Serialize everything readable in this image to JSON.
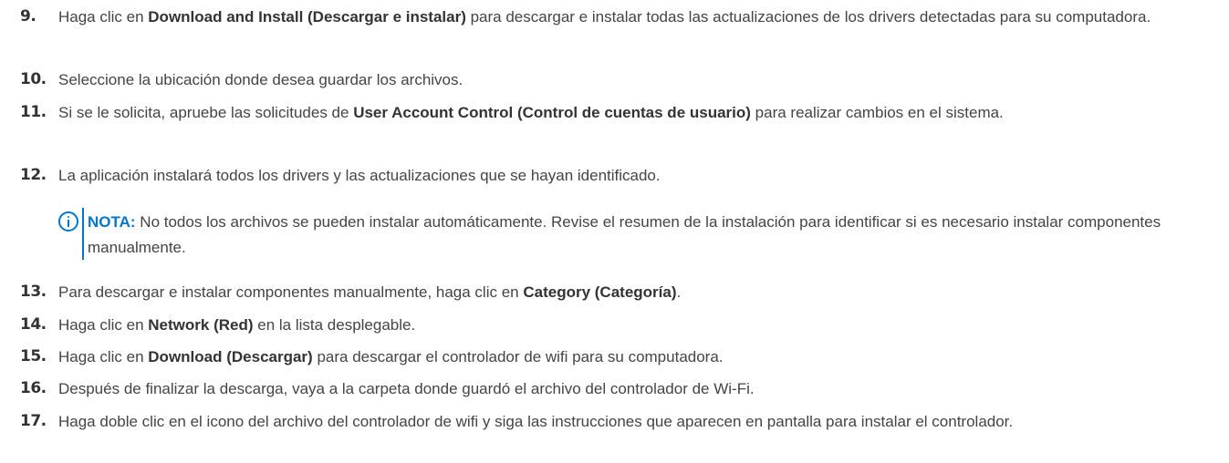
{
  "steps": [
    {
      "num": "9.",
      "t1": "Haga clic en ",
      "b1": "Download and Install (Descargar e instalar)",
      "t2": " para descargar e instalar todas las actualizaciones de los drivers detectadas para su computadora."
    },
    {
      "num": "10.",
      "t1": "Seleccione la ubicación donde desea guardar los archivos."
    },
    {
      "num": "11.",
      "t1": "Si se le solicita, apruebe las solicitudes de ",
      "b1": "User Account Control (Control de cuentas de usuario)",
      "t2": " para realizar cambios en el sistema."
    },
    {
      "num": "12.",
      "t1": "La aplicación instalará todos los drivers y las actualizaciones que se hayan identificado."
    },
    {
      "num": "13.",
      "t1": "Para descargar e instalar componentes manualmente, haga clic en ",
      "b1": "Category (Categoría)",
      "t2": "."
    },
    {
      "num": "14.",
      "t1": "Haga clic en ",
      "b1": "Network (Red)",
      "t2": " en la lista desplegable."
    },
    {
      "num": "15.",
      "t1": "Haga clic en ",
      "b1": "Download (Descargar)",
      "t2": " para descargar el controlador de wifi para su computadora."
    },
    {
      "num": "16.",
      "t1": "Después de finalizar la descarga, vaya a la carpeta donde guardó el archivo del controlador de Wi-Fi."
    },
    {
      "num": "17.",
      "t1": "Haga doble clic en el icono del archivo del controlador de wifi y siga las instrucciones que aparecen en pantalla para instalar el controlador."
    }
  ],
  "note": {
    "icon": "info-icon",
    "label": "NOTA:",
    "text": " No todos los archivos se pueden instalar automáticamente. Revise el resumen de la instalación para identificar si es necesario instalar componentes manualmente."
  },
  "colors": {
    "accent": "#0076ce",
    "text": "#444444"
  }
}
